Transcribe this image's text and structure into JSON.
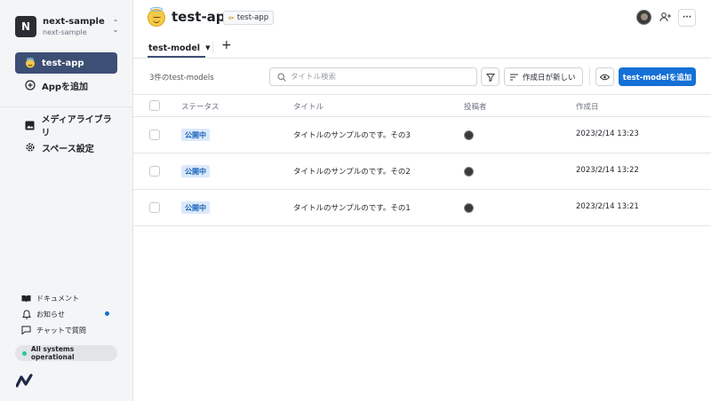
{
  "sidebar": {
    "space_initial": "N",
    "space_name": "next-sample",
    "space_sub": "next-sample",
    "items": [
      {
        "label": "test-app",
        "icon": "smiling-face-with-halo-icon",
        "active": true
      },
      {
        "label": "Appを追加",
        "icon": "plus-circle-icon"
      },
      {
        "label": "メディアライブラリ",
        "icon": "image-icon"
      },
      {
        "label": "スペース設定",
        "icon": "gear-icon"
      }
    ],
    "footer": [
      {
        "label": "ドキュメント",
        "icon": "book-icon"
      },
      {
        "label": "お知らせ",
        "icon": "bell-icon"
      },
      {
        "label": "チャットで質問",
        "icon": "chat-icon"
      }
    ],
    "status": "All systems operational",
    "colors": {
      "active_bg": "#3d4f75",
      "status_dot": "#2ec4a2",
      "notif_dot": "#1570d6"
    }
  },
  "header": {
    "title": "test-app",
    "badge": "test-app",
    "tabs": [
      {
        "label": "test-model",
        "active": true
      }
    ],
    "add_tab": "+",
    "more": "···"
  },
  "toolbar": {
    "count": "3件のtest-models",
    "search_placeholder": "タイトル検索",
    "sort_label": "作成日が新しい",
    "add_label": "test-modelを追加",
    "accent": "#1570d6"
  },
  "table": {
    "columns": [
      "ステータス",
      "タイトル",
      "投稿者",
      "作成日"
    ],
    "rows": [
      {
        "status": "公開中",
        "title": "タイトルのサンプルのです。その3",
        "date": "2023/2/14 13:23"
      },
      {
        "status": "公開中",
        "title": "タイトルのサンプルのです。その2",
        "date": "2023/2/14 13:22"
      },
      {
        "status": "公開中",
        "title": "タイトルのサンプルのです。その1",
        "date": "2023/2/14 13:21"
      }
    ]
  }
}
